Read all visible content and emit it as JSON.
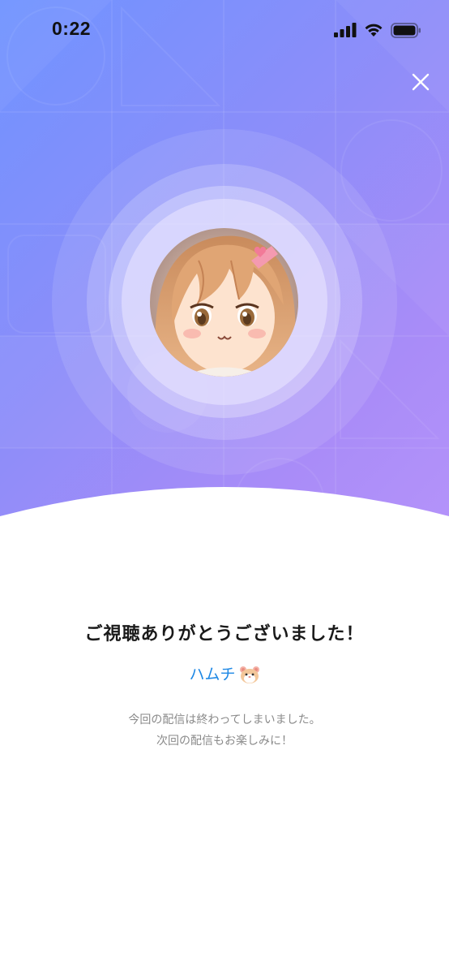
{
  "status_bar": {
    "time": "0:22",
    "icons": [
      "cellular-signal-icon",
      "wifi-icon",
      "battery-icon"
    ]
  },
  "header": {
    "close_icon": "close-icon",
    "gradient_colors": [
      "#6f93ff",
      "#8f8df9",
      "#a98cf8",
      "#b694fa"
    ]
  },
  "avatar": {
    "icon": "streamer-avatar"
  },
  "end_screen": {
    "title": "ご視聴ありがとうございました！",
    "streamer_name": "ハムチ",
    "streamer_emoji_icon": "hamster-face-icon",
    "message_line_1": "今回の配信は終わってしまいました。",
    "message_line_2": "次回の配信もお楽しみに！"
  },
  "colors": {
    "accent": "#1e88e5",
    "title": "#1a1a1a",
    "muted": "#8a8a8a"
  }
}
